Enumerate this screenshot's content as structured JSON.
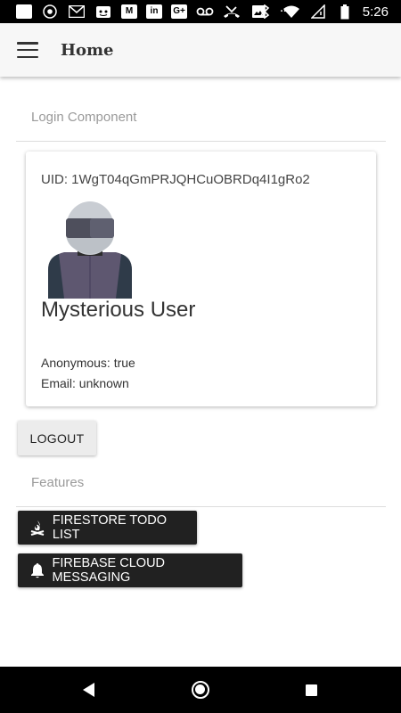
{
  "status_bar": {
    "time": "5:26",
    "icons": [
      "app-icon",
      "chrome-icon",
      "gmail-icon",
      "reddit-icon",
      "medium-icon",
      "linkedin-icon",
      "google-plus-icon",
      "voicemail-icon",
      "missed-call-icon",
      "image-icon",
      "more-icon",
      "bluetooth-icon",
      "wifi-icon",
      "no-signal-icon",
      "battery-icon"
    ],
    "medium_label": "M",
    "linkedin_label": "in",
    "gplus_label": "G+",
    "more_label": "···"
  },
  "app_bar": {
    "title": "Home"
  },
  "login_section": {
    "header": "Login Component"
  },
  "user_card": {
    "uid": "UID: 1WgT04qGmPRJQHCuOBRDq4I1gRo2",
    "name": "Mysterious User",
    "anonymous": "Anonymous: true",
    "email": "Email: unknown"
  },
  "logout_button": {
    "label": "LOGOUT"
  },
  "features_section": {
    "header": "Features"
  },
  "feature_buttons": [
    {
      "label": "FIRESTORE TODO LIST",
      "icon": "campfire-icon"
    },
    {
      "label": "FIREBASE CLOUD MESSAGING",
      "icon": "bell-icon"
    }
  ],
  "colors": {
    "app_bar_bg": "#f7f7f7",
    "dark_button_bg": "#212121",
    "light_button_bg": "#ececec",
    "section_header_text": "#9a9a9a"
  }
}
